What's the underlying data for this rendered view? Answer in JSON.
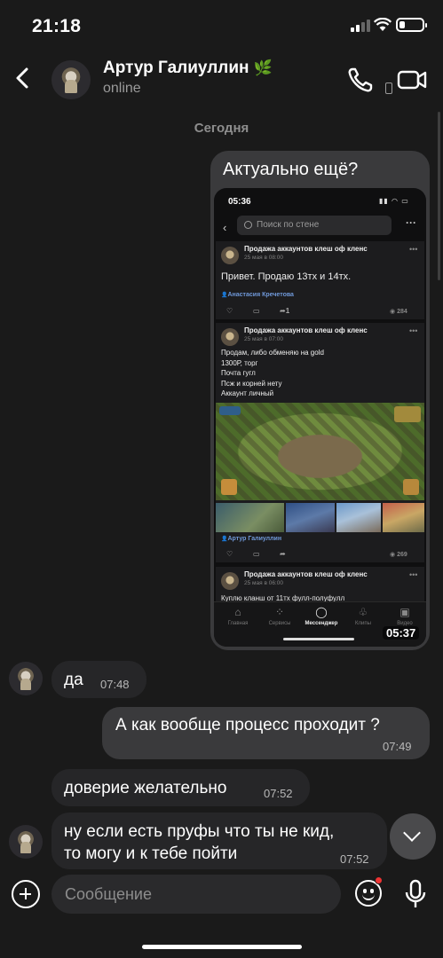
{
  "status_bar": {
    "time": "21:18",
    "battery_level": 0.25
  },
  "header": {
    "contact_name": "Артур Галиуллин",
    "name_emoji": "🌿",
    "status": "online"
  },
  "date_separator": "Сегодня",
  "outgoing_card": {
    "text": "Актуально ещё?",
    "screenshot": {
      "time": "05:36",
      "search_placeholder": "Поиск по стене",
      "posts": [
        {
          "title": "Продажа аккаунтов клеш оф кленс",
          "date": "25 мая в 08:00",
          "body": [
            "Привет. Продаю 13тх и 14тх."
          ],
          "author": "Анастасия Кречетова",
          "reposts": "1",
          "views": "284"
        },
        {
          "title": "Продажа аккаунтов клеш оф кленс",
          "date": "25 мая в 07:00",
          "body": [
            "Продам, либо обменяю на gold",
            "1300Р, торг",
            "Почта гугл",
            "Псж и корней нету",
            "Аккаунт личный"
          ],
          "author": "Артур Галиуллин",
          "views": "269"
        },
        {
          "title": "Продажа аккаунтов клеш оф кленс",
          "date": "25 мая в 06:00",
          "body": [
            "Куплю кланш от 11тх фулл-полуфулл"
          ]
        }
      ],
      "tabs": [
        "Главная",
        "Сервисы",
        "Мессенджер",
        "Клипы",
        "Видео"
      ],
      "active_tab": "Мессенджер",
      "timestamp_overlay": "05:37"
    }
  },
  "messages": [
    {
      "direction": "in",
      "text": "да",
      "time": "07:48"
    },
    {
      "direction": "out",
      "text": "А как вообще процесс проходит ?",
      "time": "07:49"
    },
    {
      "direction": "in",
      "text": "доверие желательно",
      "time": "07:52"
    },
    {
      "direction": "in",
      "text_lines": [
        "ну если есть пруфы что ты не кид,",
        "то могу и к тебе пойти"
      ],
      "time": "07:52"
    }
  ],
  "composer": {
    "placeholder": "Сообщение"
  },
  "icons": [
    "back-chevron-icon",
    "phone-call-icon",
    "video-call-icon",
    "plus-icon",
    "sticker-icon",
    "microphone-icon",
    "scroll-down-icon"
  ]
}
